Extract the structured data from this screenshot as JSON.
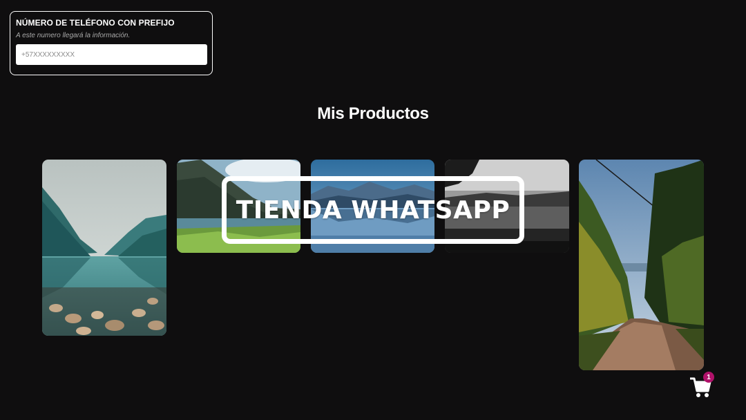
{
  "phone_form": {
    "title": "NÚMERO DE TELÉFONO CON PREFIJO",
    "hint": "A este numero llegará la información.",
    "input_value": "",
    "input_placeholder": "+57XXXXXXXXX"
  },
  "page": {
    "title": "Mis Productos"
  },
  "banner": {
    "text": "TIENDA WHATSAPP"
  },
  "products": [
    {
      "image": "mountain-lake-teal"
    },
    {
      "image": "mountain-lake-grass"
    },
    {
      "image": "mountain-lake-reflection"
    },
    {
      "image": "lake-black-white"
    },
    {
      "image": "forest-dirt-road"
    }
  ],
  "cart": {
    "icon": "cart-icon",
    "count": "1",
    "badge_color": "#b0126a"
  }
}
